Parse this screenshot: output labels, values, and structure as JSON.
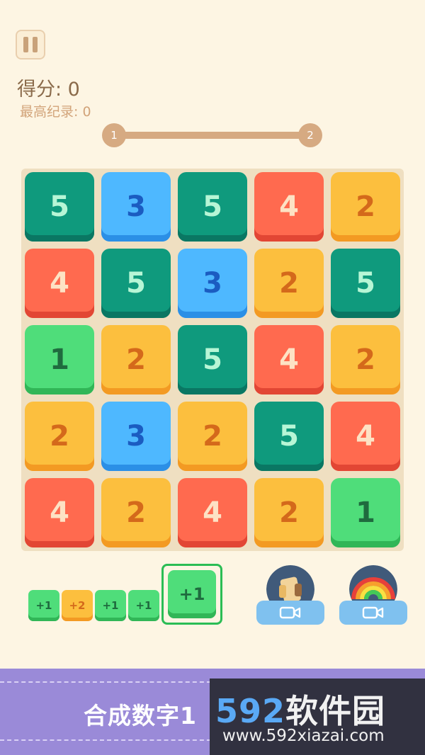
{
  "score": {
    "label": "得分: 0"
  },
  "best": {
    "label": "最高纪录: 0"
  },
  "level": {
    "from": "1",
    "to": "2"
  },
  "board": {
    "rows": [
      [
        "5",
        "3",
        "5",
        "4",
        "2"
      ],
      [
        "4",
        "5",
        "3",
        "2",
        "5"
      ],
      [
        "1",
        "2",
        "5",
        "4",
        "2"
      ],
      [
        "2",
        "3",
        "2",
        "5",
        "4"
      ],
      [
        "4",
        "2",
        "4",
        "2",
        "1"
      ]
    ]
  },
  "queue": [
    "+1",
    "+2",
    "+1",
    "+1"
  ],
  "current_piece": "+1",
  "powerups": [
    {
      "name": "hammer",
      "icon": "hammer-icon",
      "action_icon": "video-camera-icon"
    },
    {
      "name": "rainbow",
      "icon": "rainbow-icon",
      "action_icon": "video-camera-icon"
    }
  ],
  "banner": {
    "title": "合成数字1"
  },
  "watermark": {
    "brand_digits": "592",
    "brand_text": "软件园",
    "url": "www.592xiazai.com"
  },
  "colors": {
    "background": "#fdf5e3",
    "tile_1": "#4fdd7a",
    "tile_2": "#fcbf3e",
    "tile_3": "#4eb8ff",
    "tile_4": "#ff6a4f",
    "tile_5": "#0f9a7d",
    "banner": "#9a8ad8"
  }
}
